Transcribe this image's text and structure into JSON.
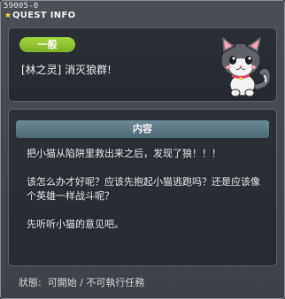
{
  "quest": {
    "id": "59005-0",
    "window_title": "QUEST INFO",
    "category": "一般",
    "name": "[林之灵] 消灭狼群!",
    "content_header": "内容",
    "description": [
      "把小猫从陷阱里救出来之后，发现了狼！！！",
      "该怎么办才好呢？应该先抱起小猫逃跑吗？还是应该像个英雄一样战斗呢？",
      "先听听小猫的意见吧。"
    ],
    "status_label": "狀態:",
    "status_value": "可開始 / 不可執行任務"
  },
  "colors": {
    "badge": "#8ec234",
    "header": "#5b7883",
    "star": "#ffd24a"
  },
  "icons": {
    "title_star": "star-icon",
    "npc": "cat-portrait"
  }
}
